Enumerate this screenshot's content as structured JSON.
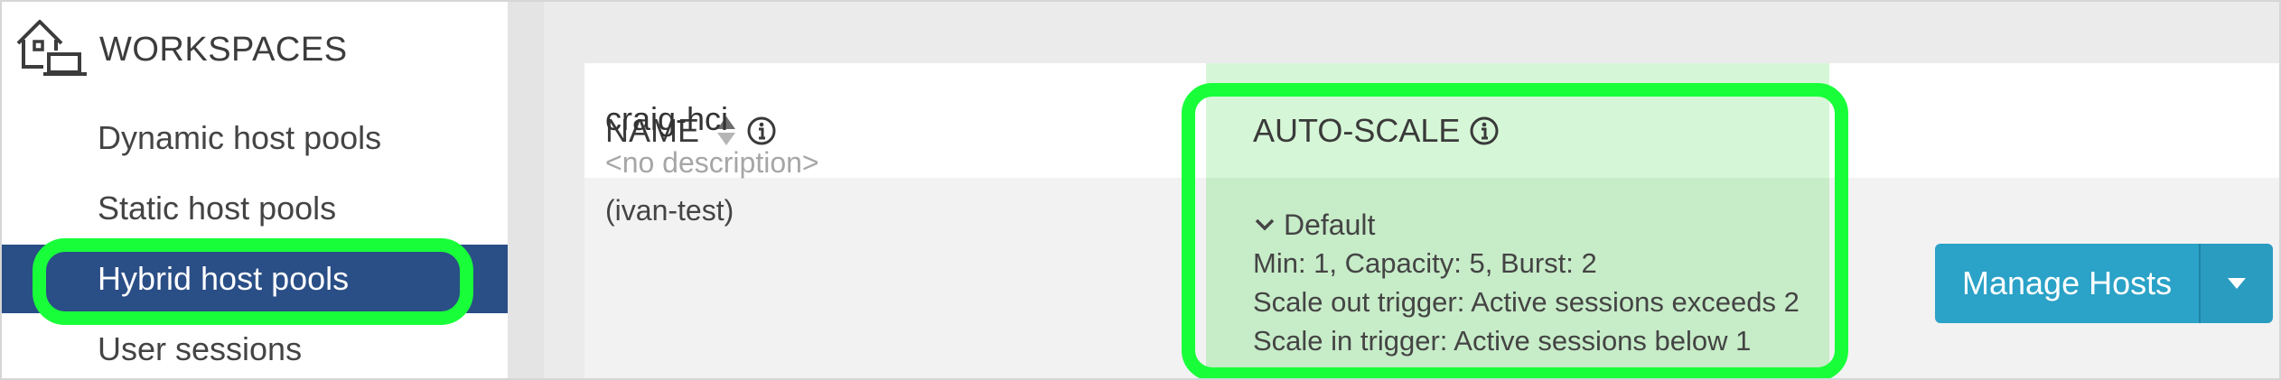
{
  "sidebar": {
    "section_title": "WORKSPACES",
    "section_icon": "home-laptop-icon",
    "items": [
      {
        "label": "Dynamic host pools",
        "active": false
      },
      {
        "label": "Static host pools",
        "active": false
      },
      {
        "label": "Hybrid host pools",
        "active": true
      },
      {
        "label": "User sessions",
        "active": false
      }
    ]
  },
  "table": {
    "columns": {
      "name": "NAME",
      "autoscale": "AUTO-SCALE"
    },
    "rows": [
      {
        "name": "craig-hci",
        "description": "<no description>",
        "tag": "(ivan-test)",
        "autoscale": {
          "profile": "Default",
          "capacity": "Min: 1, Capacity: 5, Burst: 2",
          "scale_out": "Scale out trigger: Active sessions exceeds 2",
          "scale_in": "Scale in trigger: Active sessions below 1"
        },
        "action_label": "Manage Hosts"
      }
    ]
  },
  "colors": {
    "sidebar_active": "#2a4e86",
    "highlight": "#18ff3a",
    "button": "#2ba2c7",
    "autoscale_tint": "#d6f7d7"
  }
}
